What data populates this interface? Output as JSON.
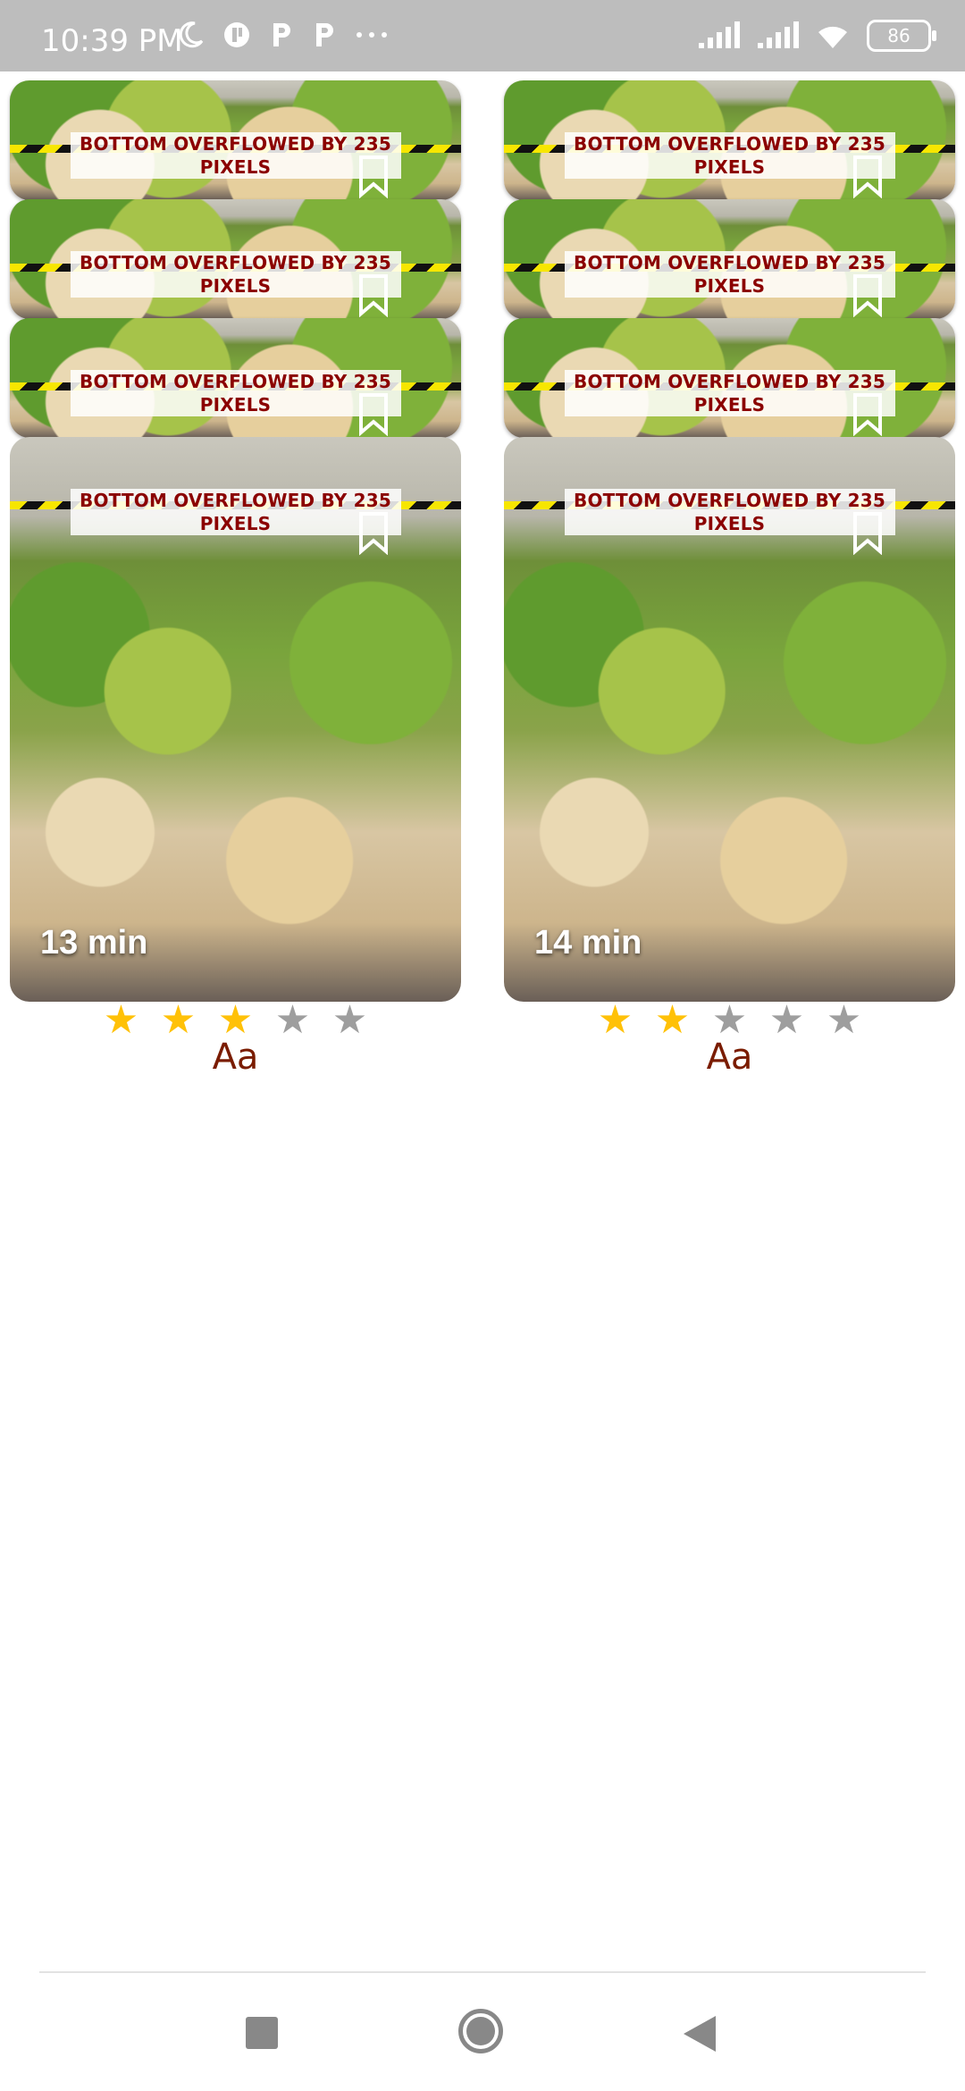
{
  "status_bar": {
    "time": "10:39 PM",
    "left_icons": [
      "moon-icon",
      "app-notification-icon",
      "p-notification-icon",
      "p-notification-icon",
      "more-dots-icon"
    ],
    "battery": "86"
  },
  "cards": [
    {
      "overflow_message": "BOTTOM OVERFLOWED BY 235 PIXELS",
      "duration": "13 min",
      "rating": 3,
      "max_rating": 5,
      "title": "Aa"
    },
    {
      "overflow_message": "BOTTOM OVERFLOWED BY 235 PIXELS",
      "duration": "14 min",
      "rating": 2,
      "max_rating": 5,
      "title": "Aa"
    }
  ],
  "colors": {
    "star_filled": "#ffc107",
    "star_empty": "#9e9e9e",
    "title": "#7a1c00",
    "overflow_text": "#8b0000"
  }
}
